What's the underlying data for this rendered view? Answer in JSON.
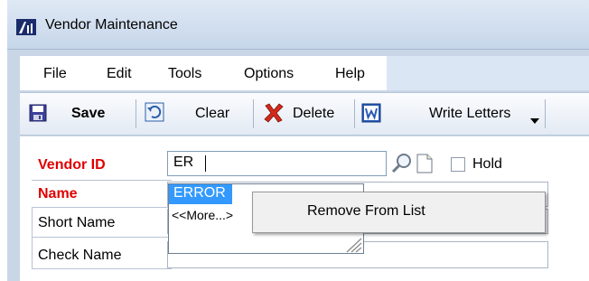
{
  "window": {
    "title": "Vendor Maintenance",
    "logo_icon": "gp-logo-icon"
  },
  "menu": {
    "items": [
      {
        "label": "File"
      },
      {
        "label": "Edit"
      },
      {
        "label": "Tools"
      },
      {
        "label": "Options"
      },
      {
        "label": "Help"
      }
    ]
  },
  "toolbar": {
    "save_label": "Save",
    "clear_label": "Clear",
    "delete_label": "Delete",
    "write_letters_label": "Write Letters",
    "icons": {
      "save": "floppy-disk-icon",
      "clear": "clear-icon",
      "delete": "red-x-icon",
      "write_letters": "word-icon",
      "dropdown": "chevron-down-icon"
    }
  },
  "form": {
    "vendor_id_label": "Vendor ID",
    "vendor_id_value": "ER",
    "name_label": "Name",
    "short_name_label": "Short Name",
    "check_name_label": "Check Name",
    "hold_label": "Hold",
    "hold_checked": false
  },
  "autocomplete": {
    "items": [
      {
        "label": "ERROR",
        "selected": true
      },
      {
        "label": "<<More...>"
      }
    ]
  },
  "context_menu": {
    "items": [
      {
        "label": "Remove From List"
      }
    ]
  },
  "colors": {
    "required_label": "#e00000",
    "selection": "#3399ff",
    "menu_band": "#dbe6f5"
  }
}
